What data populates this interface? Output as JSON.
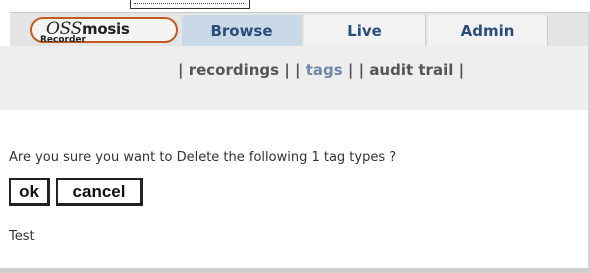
{
  "app": {
    "logo_main": "OSSmosis",
    "logo_main_part1": "OSS",
    "logo_main_part2": "mosis",
    "logo_sub": "Recorder"
  },
  "tabs": [
    {
      "label": "Browse",
      "active": true
    },
    {
      "label": "Live",
      "active": false
    },
    {
      "label": "Admin",
      "active": false
    }
  ],
  "subnav": {
    "items": [
      "recordings",
      "tags",
      "audit trail"
    ],
    "current": "tags"
  },
  "dialog": {
    "question": "Are you sure you want to Delete the following 1 tag types ?",
    "ok_label": "ok",
    "cancel_label": "cancel",
    "items": [
      "Test"
    ]
  },
  "colors": {
    "tab_text": "#2a4d7a",
    "active_tab_bg": "#c9d9e8",
    "logo_border": "#c35a1f",
    "subnav_current": "#6f88a8"
  }
}
